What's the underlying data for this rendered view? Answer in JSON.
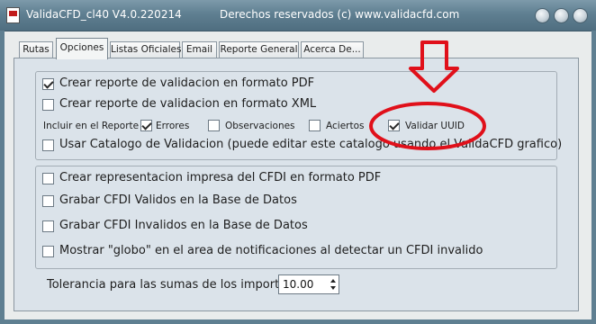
{
  "window": {
    "title": "ValidaCFD_cl40 V4.0.220214",
    "subtitle": "Derechos reservados (c) www.validacfd.com"
  },
  "tabs": [
    {
      "label": "Rutas"
    },
    {
      "label": "Opciones"
    },
    {
      "label": "Listas Oficiales"
    },
    {
      "label": "Email"
    },
    {
      "label": "Reporte General"
    },
    {
      "label": "Acerca De..."
    }
  ],
  "options": {
    "reporte_pdf": {
      "label": "Crear reporte de validacion en formato PDF",
      "checked": true
    },
    "reporte_xml": {
      "label": "Crear reporte de validacion en formato XML",
      "checked": false
    },
    "incluir_label": "Incluir en el Reporte",
    "incluir": [
      {
        "label": "Errores",
        "checked": true
      },
      {
        "label": "Observaciones",
        "checked": false
      },
      {
        "label": "Aciertos",
        "checked": false
      },
      {
        "label": "Validar UUID",
        "checked": true
      }
    ],
    "catalogo": {
      "label": "Usar Catalogo de Validacion (puede editar este catalogo usando el ValidaCFD grafico)",
      "checked": false
    },
    "representacion_pdf": {
      "label": "Crear representacion impresa del CFDI en formato PDF",
      "checked": false
    },
    "grabar_validos": {
      "label": "Grabar CFDI Validos en la Base de Datos",
      "checked": false
    },
    "grabar_invalidos": {
      "label": "Grabar CFDI Invalidos en la Base de Datos",
      "checked": false
    },
    "globo": {
      "label": "Mostrar \"globo\" en el area de notificaciones al detectar un CFDI invalido",
      "checked": false
    },
    "tolerancia_label": "Tolerancia para las sumas de los importes",
    "tolerancia_value": "10.00"
  },
  "colors": {
    "annotation": "#e0101a",
    "titlebar": "#5f7f91"
  }
}
